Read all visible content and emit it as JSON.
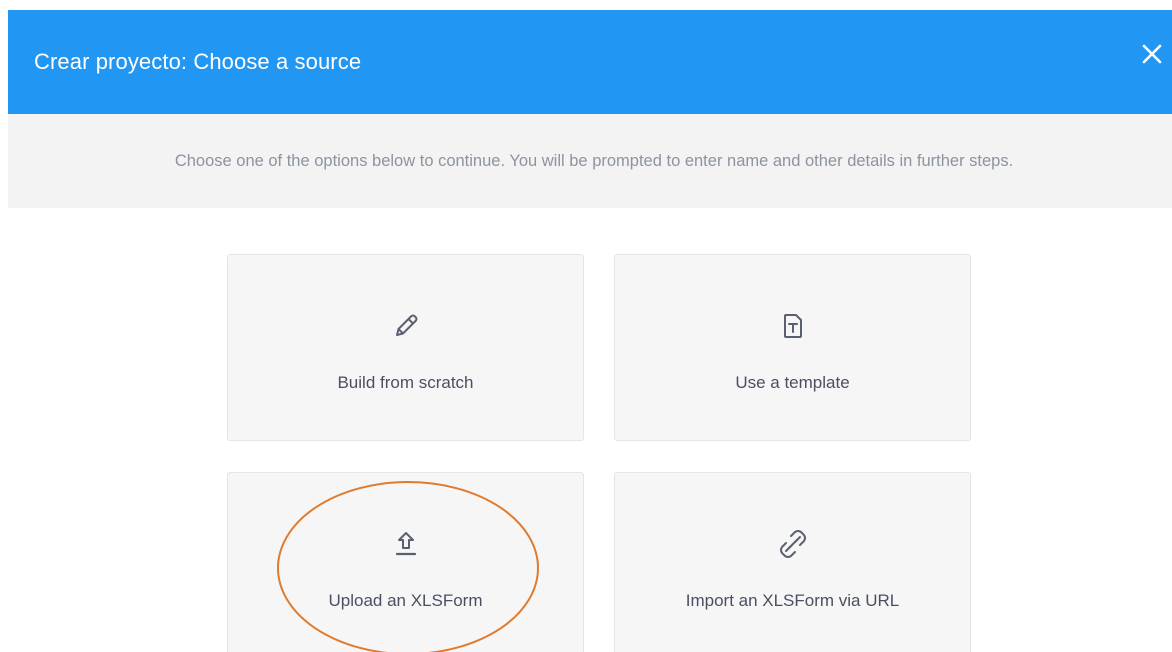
{
  "modal": {
    "title": "Crear proyecto: Choose a source",
    "close_icon": "close-icon",
    "subheader": "Choose one of the options below to continue. You will be prompted to enter name and other details in further steps."
  },
  "options": [
    {
      "label": "Build from scratch",
      "icon": "pencil-icon"
    },
    {
      "label": "Use a template",
      "icon": "template-file-icon"
    },
    {
      "label": "Upload an XLSForm",
      "icon": "upload-icon"
    },
    {
      "label": "Import an XLSForm via URL",
      "icon": "link-icon"
    }
  ],
  "colors": {
    "header_bg": "#2196f3",
    "subheader_bg": "#f3f3f4",
    "card_bg": "#f6f6f7",
    "highlight": "#e07b2e"
  }
}
